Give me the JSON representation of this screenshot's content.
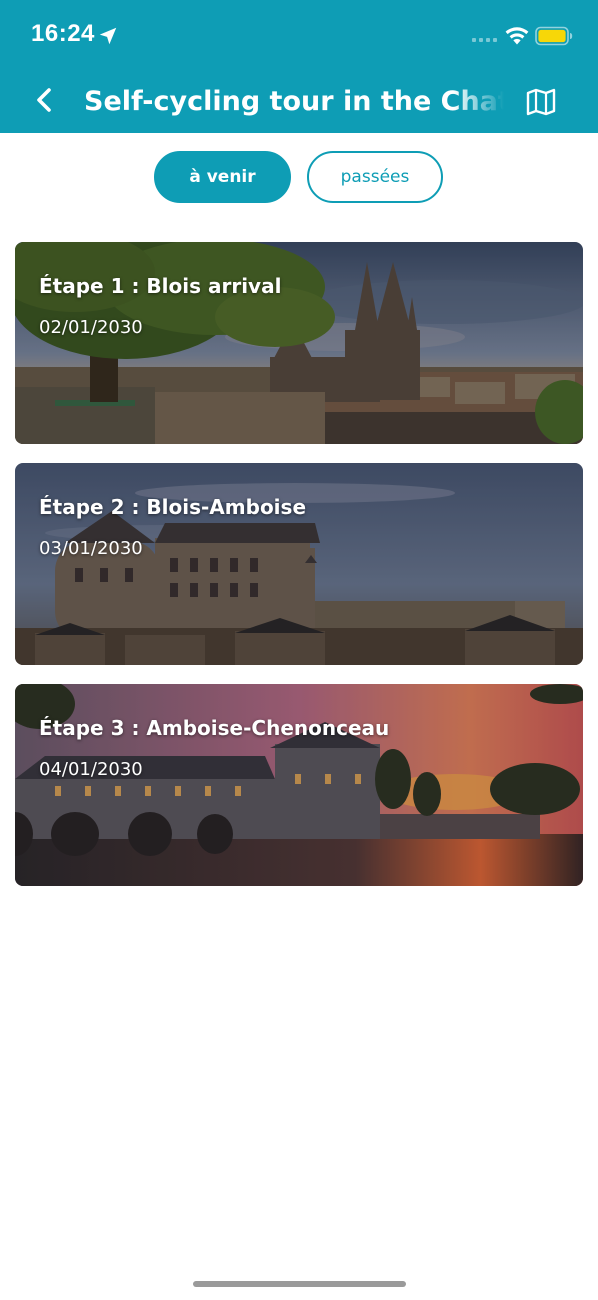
{
  "status_bar": {
    "time": "16:24",
    "icons": [
      "location-arrow-icon",
      "cellular-signal-icon",
      "wifi-icon",
      "battery-icon"
    ],
    "battery_color": "#F7D708"
  },
  "nav": {
    "title": "Self-cycling tour in the Chateaux",
    "back_icon": "chevron-left-icon",
    "map_icon": "map-icon"
  },
  "tabs": {
    "upcoming_label": "à venir",
    "past_label": "passées",
    "selected": "à venir"
  },
  "stages": [
    {
      "title": "Étape 1 : Blois arrival",
      "date": "02/01/2030"
    },
    {
      "title": "Étape 2 : Blois-Amboise",
      "date": "03/01/2030"
    },
    {
      "title": "Étape 3 : Amboise-Chenonceau",
      "date": "04/01/2030"
    }
  ],
  "colors": {
    "accent": "#0E9DB5",
    "background": "#FFFFFF",
    "text_on_accent": "#FFFFFF"
  }
}
